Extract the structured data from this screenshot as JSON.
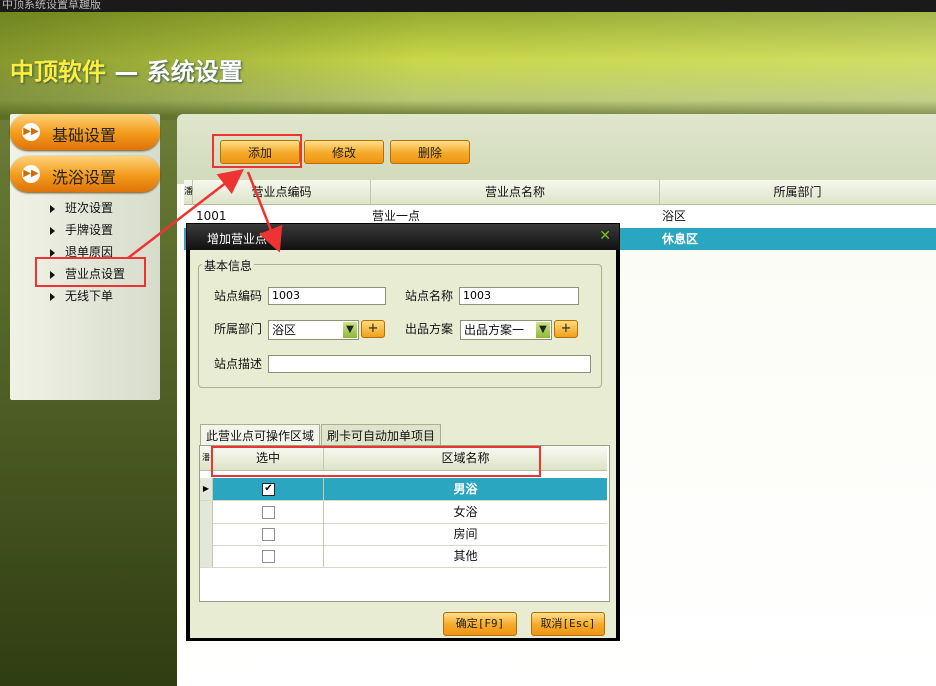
{
  "window_title": "中顶系统设置草趣版",
  "header": {
    "brand": "中顶软件",
    "subtitle": " — 系统设置"
  },
  "sidebar": {
    "groups": [
      {
        "label": "基础设置",
        "icon": "play-double-icon"
      },
      {
        "label": "洗浴设置",
        "icon": "play-double-icon"
      }
    ],
    "items": [
      {
        "label": "班次设置"
      },
      {
        "label": "手牌设置"
      },
      {
        "label": "退单原因"
      },
      {
        "label": "营业点设置"
      },
      {
        "label": "无线下单"
      }
    ]
  },
  "toolbar": {
    "add": "添加",
    "edit": "修改",
    "delete": "删除"
  },
  "main_grid": {
    "row_header": "潘",
    "columns": [
      "营业点编码",
      "营业点名称",
      "所属部门"
    ],
    "rows": [
      {
        "code": "1001",
        "name": "营业一点",
        "dept": "浴区",
        "selected": false
      },
      {
        "code": "",
        "name": "",
        "dept": "休息区",
        "selected": true
      }
    ]
  },
  "dialog": {
    "title": "增加营业点",
    "group_title": "基本信息",
    "fields": {
      "site_code_label": "站点编码",
      "site_code_value": "1003",
      "site_name_label": "站点名称",
      "site_name_value": "1003",
      "dept_label": "所属部门",
      "dept_value": "浴区",
      "plan_label": "出品方案",
      "plan_value": "出品方案一",
      "desc_label": "站点描述",
      "desc_value": "",
      "plus": "+"
    },
    "tabs": [
      "此营业点可操作区域",
      "刷卡可自动加单项目"
    ],
    "subgrid": {
      "row_header": "潘",
      "columns": [
        "选中",
        "区域名称"
      ],
      "rows": [
        {
          "area": "男浴",
          "checked": true,
          "selected": true
        },
        {
          "area": "女浴",
          "checked": false,
          "selected": false
        },
        {
          "area": "房间",
          "checked": false,
          "selected": false
        },
        {
          "area": "其他",
          "checked": false,
          "selected": false
        }
      ],
      "checkmark": "✔"
    },
    "ok": "确定[F9]",
    "cancel": "取消[Esc]"
  },
  "colors": {
    "accent_orange": "#f29a1a",
    "selection": "#2aa6c0",
    "highlight_red": "#e33333"
  }
}
